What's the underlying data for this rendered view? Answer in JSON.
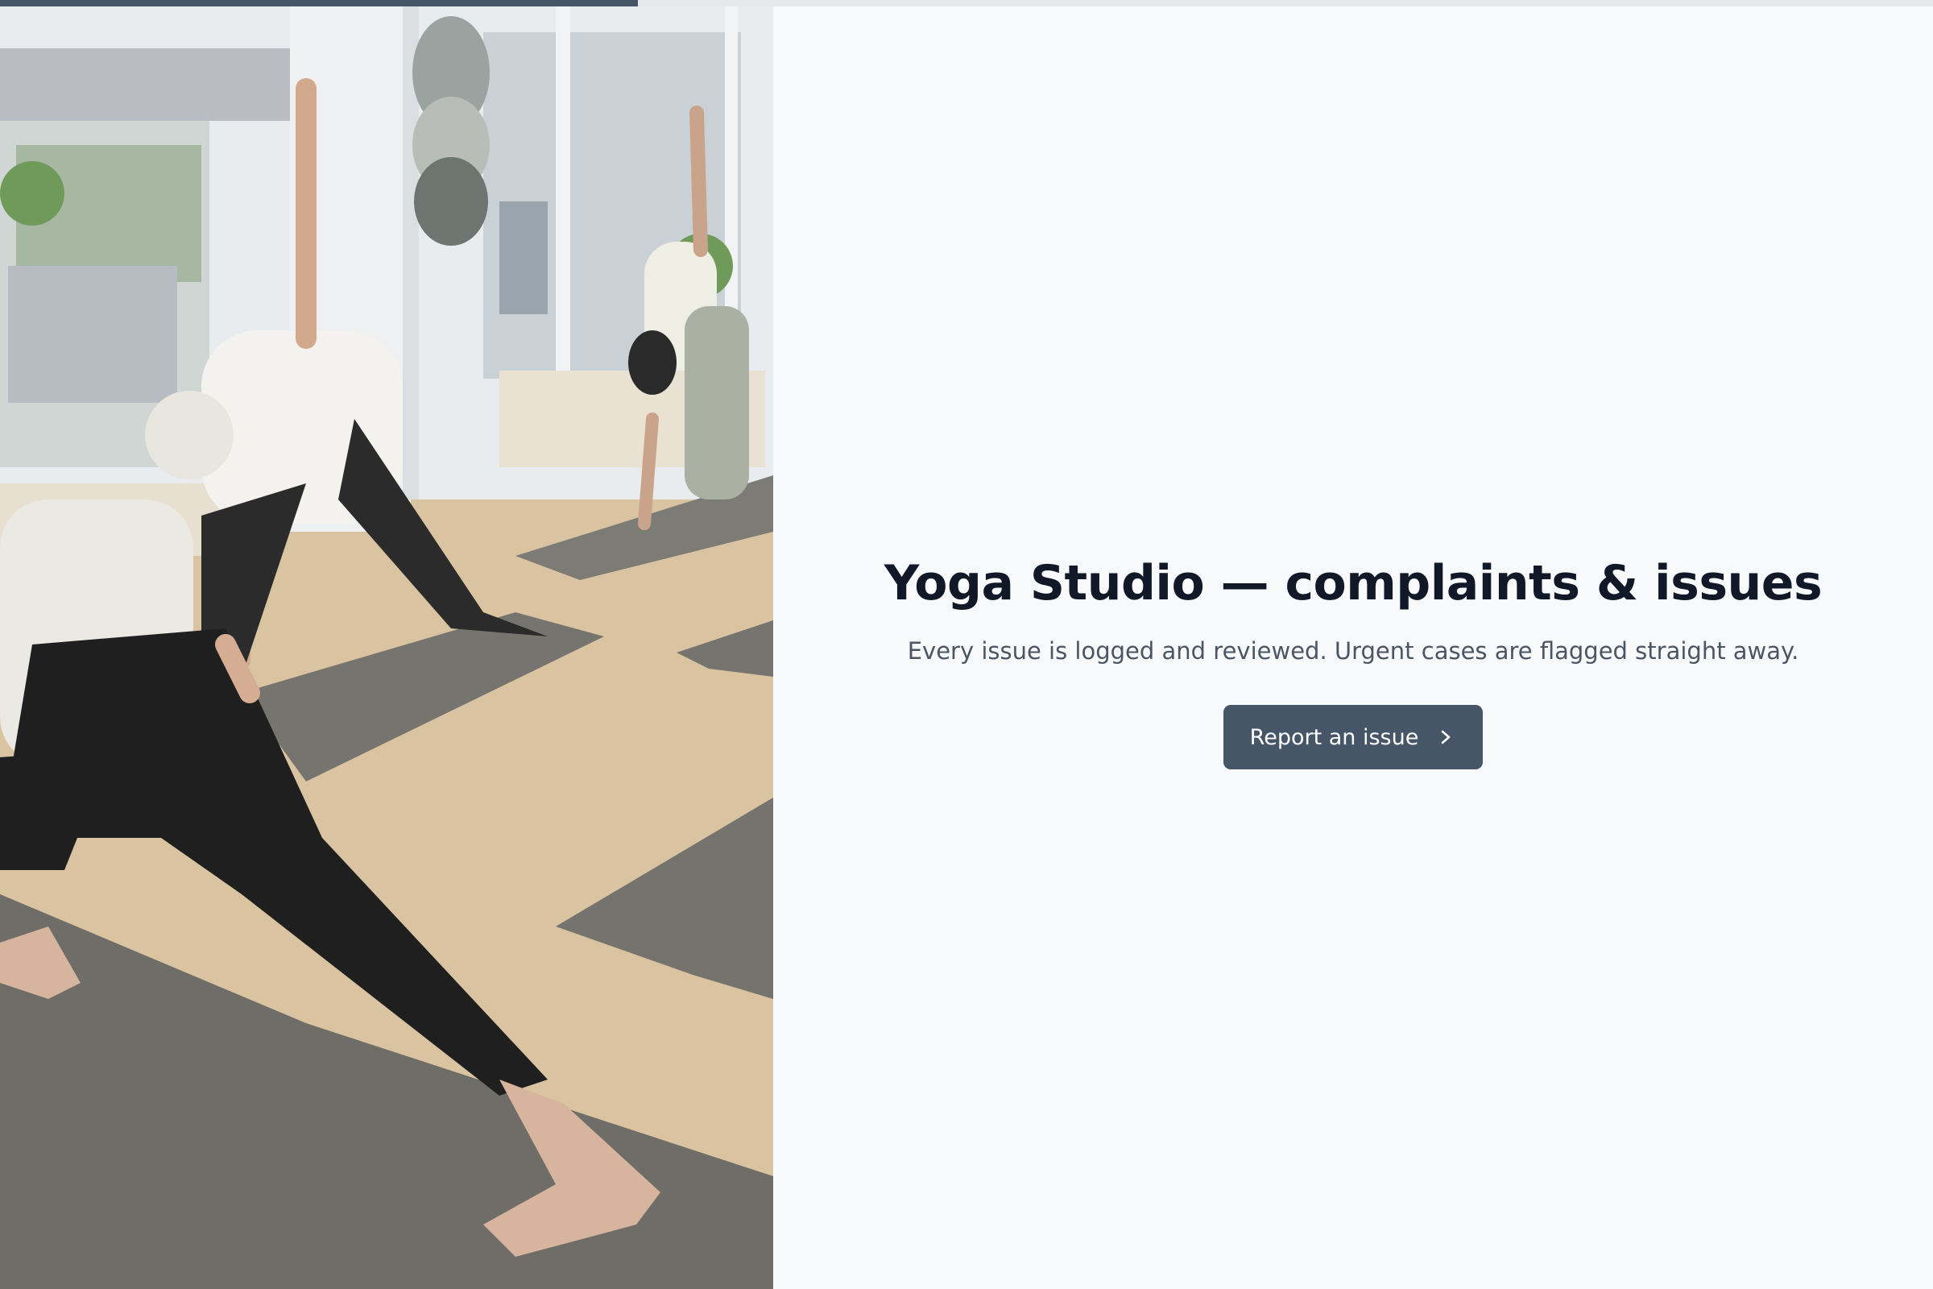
{
  "progress": {
    "value_percent": 33,
    "track_color": "#e5e7eb",
    "fill_color": "#475569"
  },
  "hero_image": {
    "icon": "photo"
  },
  "main": {
    "title": "Yoga Studio — complaints & issues",
    "subtitle": "Every issue is logged and reviewed. Urgent cases are flagged straight away.",
    "cta_label": "Report an issue",
    "cta_icon": "chevron-right-icon",
    "accent_color": "#475569"
  }
}
